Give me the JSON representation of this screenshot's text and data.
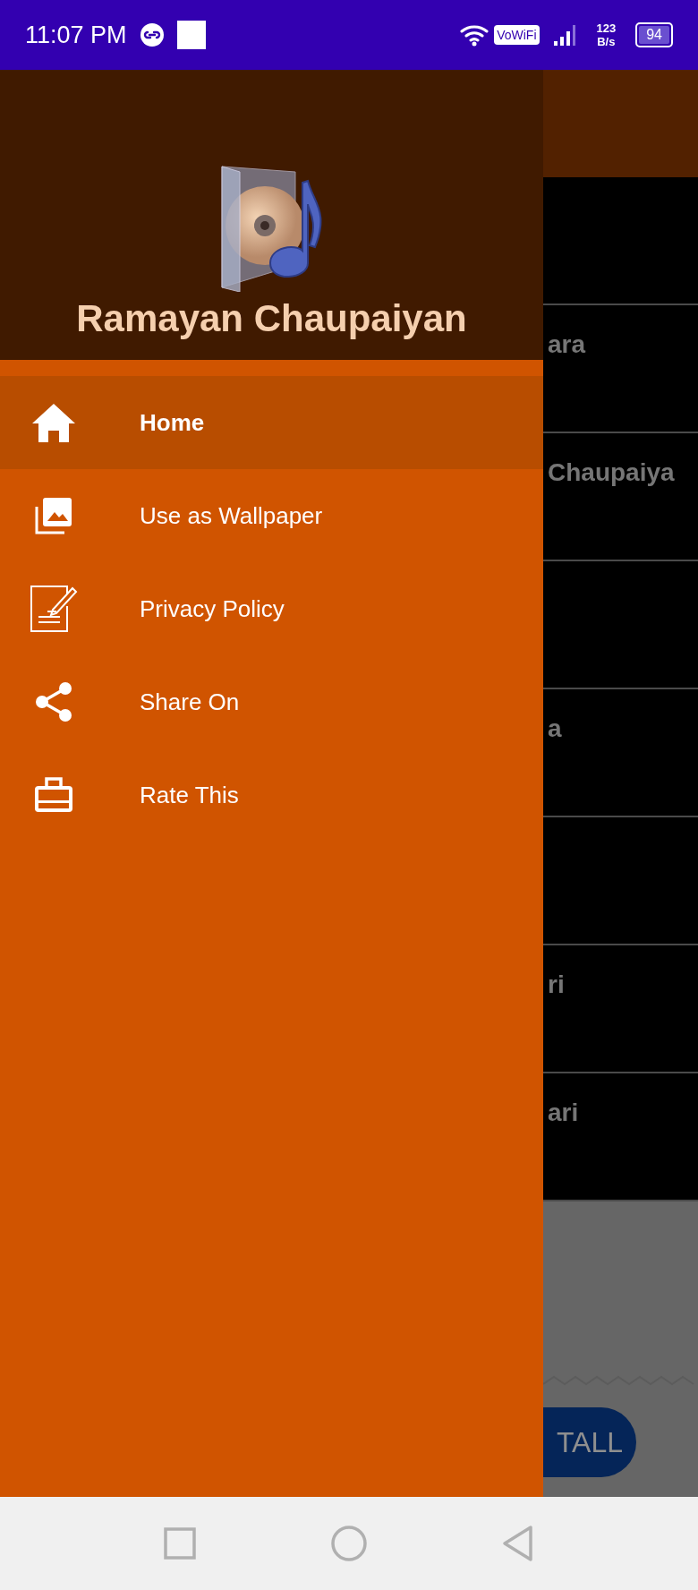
{
  "status_bar": {
    "time": "11:07 PM",
    "vowifi": "VoWiFi",
    "speed_value": "123",
    "speed_unit": "B/s",
    "battery": "94"
  },
  "drawer": {
    "app_name": "Ramayan Chaupaiyan",
    "items": [
      {
        "label": "Home",
        "kind": "home",
        "selected": true
      },
      {
        "label": "Use as Wallpaper",
        "kind": "gallery",
        "selected": false
      },
      {
        "label": "Privacy Policy",
        "kind": "note",
        "selected": false
      },
      {
        "label": "Share On",
        "kind": "share",
        "selected": false
      },
      {
        "label": "Rate This",
        "kind": "case",
        "selected": false
      }
    ]
  },
  "background_list": {
    "rows": [
      {
        "kind": "blank"
      },
      {
        "kind": "text",
        "title": "ara"
      },
      {
        "kind": "text",
        "title": "Chaupaiya"
      },
      {
        "kind": "blank"
      },
      {
        "kind": "text",
        "title": "a"
      },
      {
        "kind": "blank"
      },
      {
        "kind": "text",
        "title": "ri"
      },
      {
        "kind": "text",
        "title": "ari"
      }
    ]
  },
  "ad": {
    "button": "TALL"
  }
}
